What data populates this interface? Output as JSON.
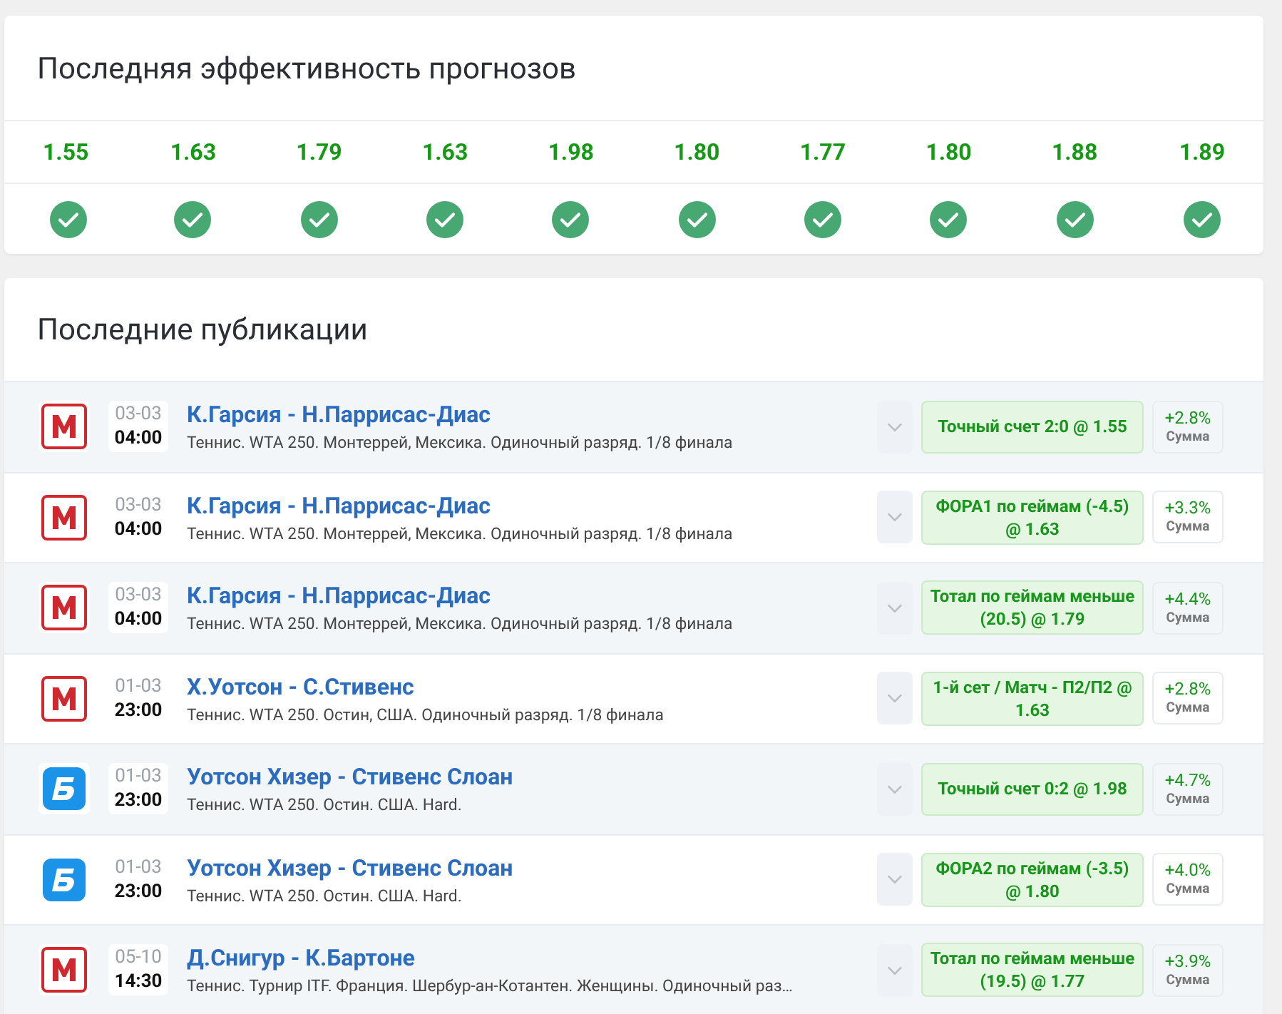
{
  "performance": {
    "title": "Последняя эффективность прогнозов",
    "items": [
      {
        "odds": "1.55",
        "won": true
      },
      {
        "odds": "1.63",
        "won": true
      },
      {
        "odds": "1.79",
        "won": true
      },
      {
        "odds": "1.63",
        "won": true
      },
      {
        "odds": "1.98",
        "won": true
      },
      {
        "odds": "1.80",
        "won": true
      },
      {
        "odds": "1.77",
        "won": true
      },
      {
        "odds": "1.80",
        "won": true
      },
      {
        "odds": "1.88",
        "won": true
      },
      {
        "odds": "1.89",
        "won": true
      }
    ]
  },
  "publications": {
    "title": "Последние публикации",
    "rows": [
      {
        "kind": "m",
        "date": "03-03",
        "time": "04:00",
        "match": "К.Гарсия - Н.Паррисас-Диас",
        "details": "Теннис. WTA 250. Монтеррей, Мексика. Одиночный разряд. 1/8 финала",
        "bet": "Точный счет 2:0 @ 1.55",
        "profit": "+2.8%",
        "profit_label": "Сумма"
      },
      {
        "kind": "m",
        "date": "03-03",
        "time": "04:00",
        "match": "К.Гарсия - Н.Паррисас-Диас",
        "details": "Теннис. WTA 250. Монтеррей, Мексика. Одиночный разряд. 1/8 финала",
        "bet": "ФОРА1 по геймам (-4.5) @ 1.63",
        "profit": "+3.3%",
        "profit_label": "Сумма"
      },
      {
        "kind": "m",
        "date": "03-03",
        "time": "04:00",
        "match": "К.Гарсия - Н.Паррисас-Диас",
        "details": "Теннис. WTA 250. Монтеррей, Мексика. Одиночный разряд. 1/8 финала",
        "bet": "Тотал по геймам меньше (20.5) @ 1.79",
        "profit": "+4.4%",
        "profit_label": "Сумма"
      },
      {
        "kind": "m",
        "date": "01-03",
        "time": "23:00",
        "match": "Х.Уотсон - С.Стивенс",
        "details": "Теннис. WTA 250. Остин, США. Одиночный разряд. 1/8 финала",
        "bet": "1-й сет / Матч - П2/П2 @ 1.63",
        "profit": "+2.8%",
        "profit_label": "Сумма"
      },
      {
        "kind": "b",
        "date": "01-03",
        "time": "23:00",
        "match": "Уотсон Хизер - Стивенс Слоан",
        "details": "Теннис. WTA 250. Остин. США. Hard.",
        "bet": "Точный счет 0:2 @ 1.98",
        "profit": "+4.7%",
        "profit_label": "Сумма"
      },
      {
        "kind": "b",
        "date": "01-03",
        "time": "23:00",
        "match": "Уотсон Хизер - Стивенс Слоан",
        "details": "Теннис. WTA 250. Остин. США. Hard.",
        "bet": "ФОРА2 по геймам (-3.5) @ 1.80",
        "profit": "+4.0%",
        "profit_label": "Сумма"
      },
      {
        "kind": "m",
        "date": "05-10",
        "time": "14:30",
        "match": "Д.Снигур - К.Бартоне",
        "details": "Теннис. Турнир ITF. Франция. Шербур-ан-Котантен. Женщины. Одиночный раз…",
        "bet": "Тотал по геймам меньше (19.5) @ 1.77",
        "profit": "+3.9%",
        "profit_label": "Сумма"
      }
    ]
  }
}
